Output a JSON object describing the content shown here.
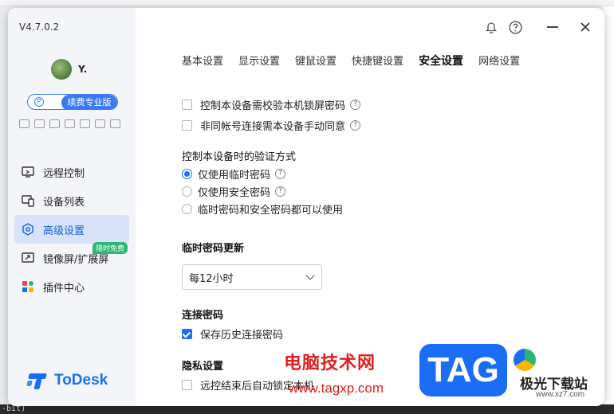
{
  "app": {
    "version": "V4.7.0.2",
    "username": "Y.",
    "pro_badge": "续费专业版",
    "logo_text": "ToDesk"
  },
  "titlebar": {
    "icons": [
      "bell-icon",
      "help-icon",
      "minimize-icon",
      "close-icon"
    ]
  },
  "sidebar": {
    "items": [
      {
        "label": "远程控制",
        "icon": "monitor-remote-icon",
        "active": false
      },
      {
        "label": "设备列表",
        "icon": "devices-icon",
        "active": false
      },
      {
        "label": "高级设置",
        "icon": "hexagon-settings-icon",
        "active": true
      },
      {
        "label": "镜像屏/扩展屏",
        "icon": "mirror-screen-icon",
        "active": false,
        "badge": "限时免费"
      },
      {
        "label": "插件中心",
        "icon": "plugin-icon",
        "active": false
      }
    ]
  },
  "tabs": [
    {
      "label": "基本设置",
      "active": false
    },
    {
      "label": "显示设置",
      "active": false
    },
    {
      "label": "键鼠设置",
      "active": false
    },
    {
      "label": "快捷键设置",
      "active": false
    },
    {
      "label": "安全设置",
      "active": true
    },
    {
      "label": "网络设置",
      "active": false
    }
  ],
  "security": {
    "checkbox_lockscreen": {
      "label": "控制本设备需校验本机锁屏密码",
      "checked": false
    },
    "checkbox_manual_confirm": {
      "label": "非同帐号连接需本设备手动同意",
      "checked": false
    },
    "verify_title": "控制本设备时的验证方式",
    "verify_options": [
      {
        "label": "仅使用临时密码",
        "selected": true,
        "help": true
      },
      {
        "label": "仅使用安全密码",
        "selected": false,
        "help": true
      },
      {
        "label": "临时密码和安全密码都可以使用",
        "selected": false,
        "help": false
      }
    ],
    "temp_pwd_title": "临时密码更新",
    "temp_pwd_value": "每12小时",
    "conn_pwd_title": "连接密码",
    "save_history": {
      "label": "保存历史连接密码",
      "checked": true
    },
    "privacy_title": "隐私设置",
    "auto_lock": {
      "label": "远控结束后自动锁定本机",
      "checked": false
    }
  },
  "watermark": {
    "cn": "电脑技术网",
    "url": "www.tagxp.com",
    "tag": "TAG",
    "jg": "极光下载站",
    "jg_url": "www.xz7.com"
  },
  "background": {
    "bottom_text": "-bit)"
  }
}
